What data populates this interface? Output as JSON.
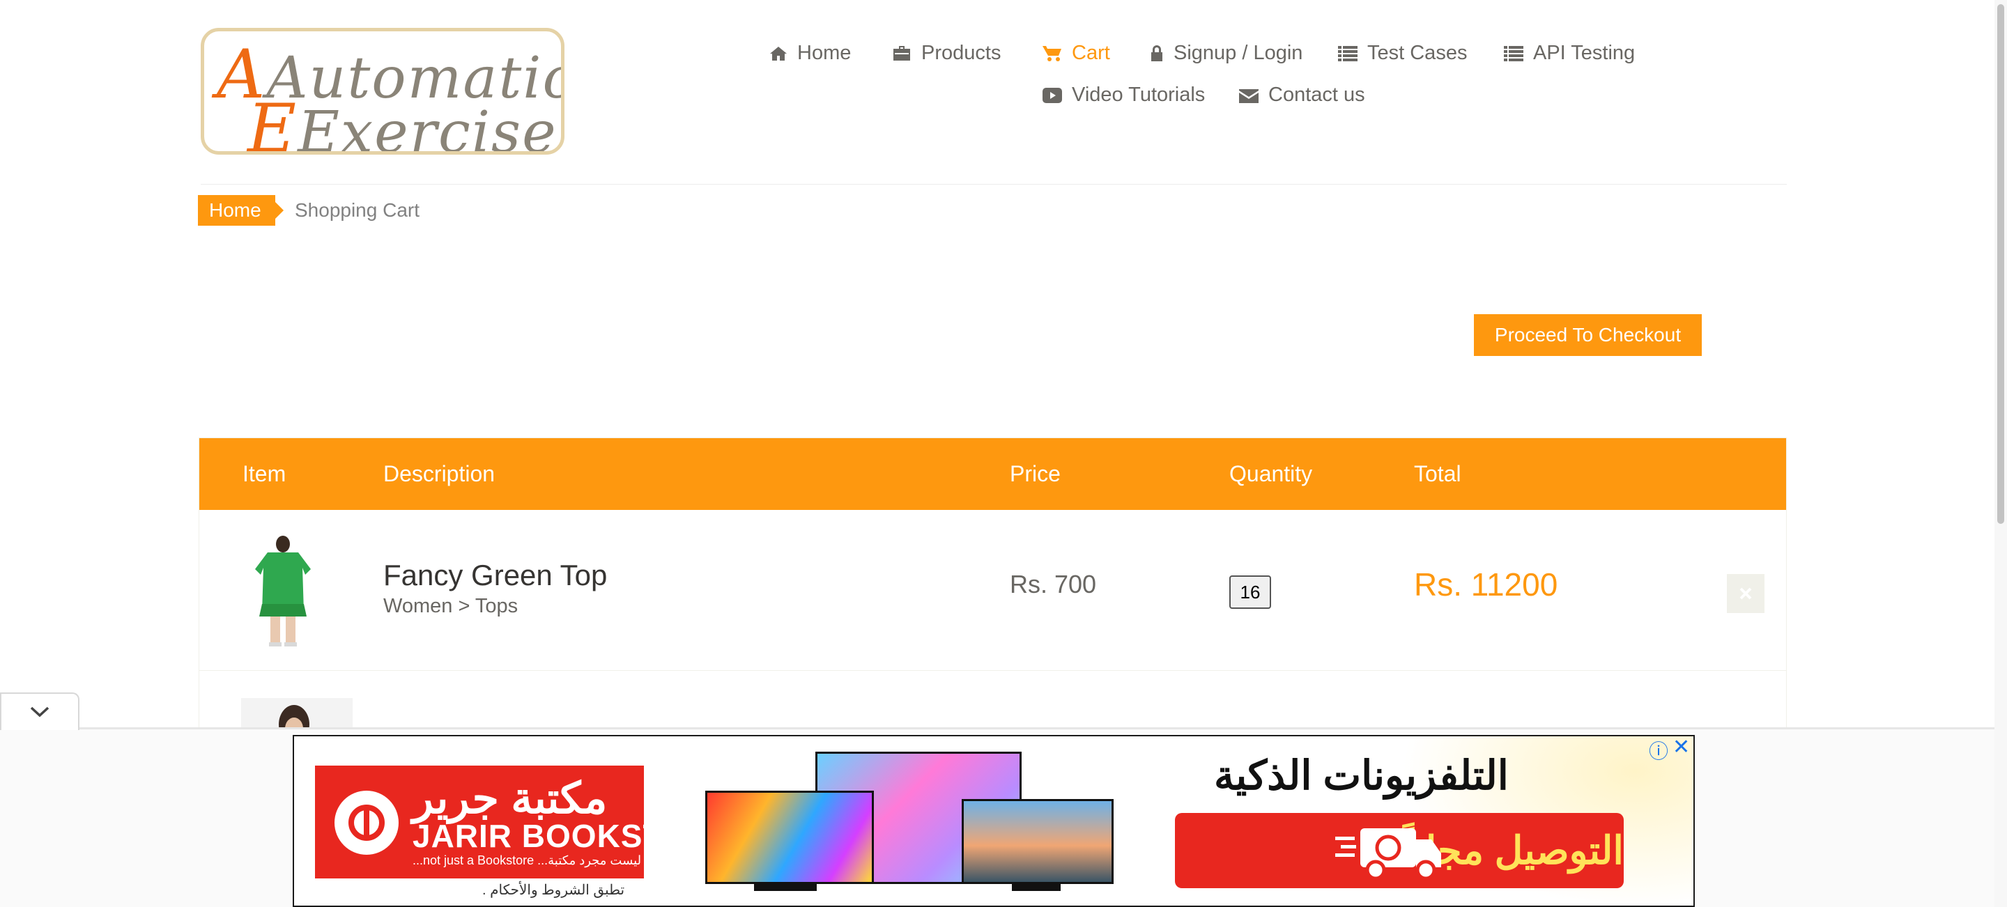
{
  "logo": {
    "line1": "Automation",
    "line2": "Exercise"
  },
  "nav": {
    "home": "Home",
    "products": "Products",
    "cart": "Cart",
    "signup": "Signup / Login",
    "test_cases": "Test Cases",
    "api_testing": "API Testing",
    "video_tutorials": "Video Tutorials",
    "contact": "Contact us",
    "active_item": "Cart"
  },
  "breadcrumb": {
    "home": "Home",
    "current": "Shopping Cart"
  },
  "checkout_label": "Proceed To Checkout",
  "cart": {
    "columns": {
      "item": "Item",
      "description": "Description",
      "price": "Price",
      "quantity": "Quantity",
      "total": "Total"
    },
    "items": [
      {
        "name": "Fancy Green Top",
        "category": "Women > Tops",
        "price": "Rs. 700",
        "quantity": "16",
        "total": "Rs. 11200",
        "image_icon": "green-top-image"
      }
    ]
  },
  "ad": {
    "brand_ar": "مكتبة جرير",
    "brand_en": "JARIR BOOKSTORE",
    "brand_sub": "...not just a Bookstore  ...ليست مجرد مكتبة",
    "terms": "تطبق الشروط والأحكام .",
    "title": "التلفزيونات الذكية",
    "cta": "التوصيل مجاناً"
  },
  "colors": {
    "accent": "#fe980f",
    "text": "#696763",
    "ad_red": "#e8271f"
  }
}
